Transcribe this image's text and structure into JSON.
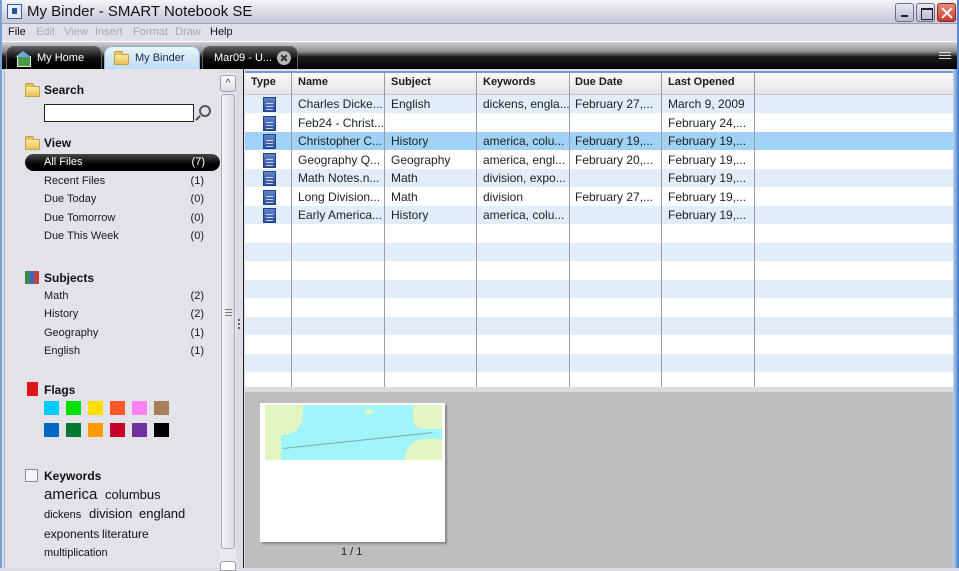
{
  "window": {
    "title": "My Binder - SMART Notebook SE",
    "controls": [
      "minimize",
      "maximize",
      "close"
    ]
  },
  "menu": [
    {
      "label": "File",
      "enabled": true
    },
    {
      "label": "Edit",
      "enabled": false
    },
    {
      "label": "View",
      "enabled": false
    },
    {
      "label": "Insert",
      "enabled": false
    },
    {
      "label": "Format",
      "enabled": false
    },
    {
      "label": "Draw",
      "enabled": false
    },
    {
      "label": "Help",
      "enabled": true
    }
  ],
  "tabs": [
    {
      "label": "My Home",
      "icon": "home-icon",
      "active": false
    },
    {
      "label": "My Binder",
      "icon": "folder-icon",
      "active": true
    },
    {
      "label": "Mar09 - U...",
      "icon": "",
      "active": false,
      "closable": true
    }
  ],
  "sidebar": {
    "search": {
      "heading": "Search",
      "value": "",
      "placeholder": ""
    },
    "view": {
      "heading": "View",
      "items": [
        {
          "label": "All Files",
          "count": "(7)",
          "selected": true
        },
        {
          "label": "Recent Files",
          "count": "(1)"
        },
        {
          "label": "Due Today",
          "count": "(0)"
        },
        {
          "label": "Due Tomorrow",
          "count": "(0)"
        },
        {
          "label": "Due This Week",
          "count": "(0)"
        }
      ]
    },
    "subjects": {
      "heading": "Subjects",
      "items": [
        {
          "label": "Math",
          "count": "(2)"
        },
        {
          "label": "History",
          "count": "(2)"
        },
        {
          "label": "Geography",
          "count": "(1)"
        },
        {
          "label": "English",
          "count": "(1)"
        }
      ]
    },
    "flags": {
      "heading": "Flags",
      "colors": [
        "#00ccff",
        "#00e000",
        "#ffe000",
        "#ff5a28",
        "#ff80f0",
        "#a87f55",
        "#0068c0",
        "#007a30",
        "#ff9a00",
        "#c8002a",
        "#7030a0",
        "#000000"
      ]
    },
    "keywords": {
      "heading": "Keywords",
      "items": [
        "america",
        "columbus",
        "dickens",
        "division",
        "england",
        "exponents",
        "literature",
        "multiplication"
      ]
    }
  },
  "table": {
    "columns": [
      "Type",
      "Name",
      "Subject",
      "Keywords",
      "Due Date",
      "Last Opened"
    ],
    "rows": [
      {
        "name": "Charles Dicke...",
        "subject": "English",
        "keywords": "dickens, engla...",
        "due": "February 27,...",
        "opened": "March 9, 2009"
      },
      {
        "name": "Feb24 - Christ...",
        "subject": "",
        "keywords": "",
        "due": "",
        "opened": "February 24,..."
      },
      {
        "name": "Christopher C...",
        "subject": "History",
        "keywords": "america, colu...",
        "due": "February 19,...",
        "opened": "February 19,...",
        "selected": true
      },
      {
        "name": "Geography Q...",
        "subject": "Geography",
        "keywords": "america, engl...",
        "due": "February 20,...",
        "opened": "February 19,..."
      },
      {
        "name": "Math Notes.n...",
        "subject": "Math",
        "keywords": "division, expo...",
        "due": "",
        "opened": "February 19,..."
      },
      {
        "name": "Long Division...",
        "subject": "Math",
        "keywords": "division",
        "due": "February 27,...",
        "opened": "February 19,..."
      },
      {
        "name": "Early America...",
        "subject": "History",
        "keywords": "america, colu...",
        "due": "",
        "opened": "February 19,..."
      }
    ]
  },
  "preview": {
    "page_indicator": "1 / 1"
  }
}
